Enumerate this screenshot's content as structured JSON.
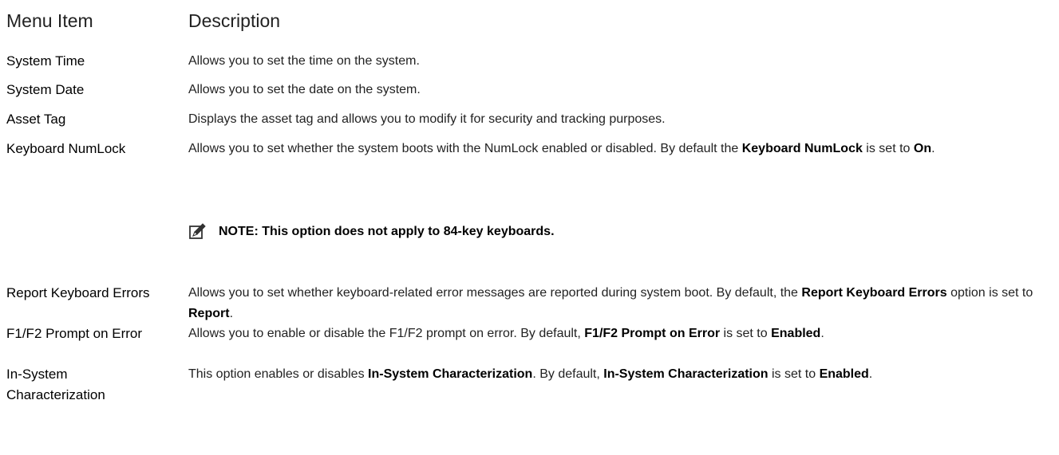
{
  "header": {
    "menu_item": "Menu Item",
    "description": "Description"
  },
  "rows": [
    {
      "item": "System Time",
      "desc": [
        {
          "t": "Allows you to set the time on the system."
        }
      ]
    },
    {
      "item": "System Date",
      "desc": [
        {
          "t": "Allows you to set the date on the system."
        }
      ]
    },
    {
      "item": "Asset Tag",
      "desc": [
        {
          "t": "Displays the asset tag and allows you to modify it for security and tracking purposes."
        }
      ]
    },
    {
      "item": "Keyboard NumLock",
      "desc": [
        {
          "t": "Allows you to set whether the system boots with the NumLock enabled or disabled. By default the "
        },
        {
          "t": "Keyboard NumLock",
          "b": true
        },
        {
          "t": " is set to "
        },
        {
          "t": "On",
          "b": true
        },
        {
          "t": "."
        }
      ],
      "note": "NOTE: This option does not apply to 84-key keyboards."
    },
    {
      "item": "Report Keyboard Errors",
      "desc": [
        {
          "t": "Allows you to set whether keyboard-related error messages are reported during system boot. By default, the "
        },
        {
          "t": "Report Keyboard Errors",
          "b": true
        },
        {
          "t": " option is set to "
        },
        {
          "t": "Report",
          "b": true
        },
        {
          "t": "."
        }
      ]
    },
    {
      "item": "F1/F2 Prompt on Error",
      "desc": [
        {
          "t": "Allows you to enable or disable the F1/F2 prompt on error. By default, "
        },
        {
          "t": "F1/F2 Prompt on Error",
          "b": true
        },
        {
          "t": " is set to "
        },
        {
          "t": "Enabled",
          "b": true
        },
        {
          "t": "."
        }
      ]
    },
    {
      "item": "In-System Characterization",
      "desc": [
        {
          "t": "This option enables or disables "
        },
        {
          "t": "In-System Characterization",
          "b": true
        },
        {
          "t": ". By default, "
        },
        {
          "t": "In-System Characterization",
          "b": true
        },
        {
          "t": " is set to "
        },
        {
          "t": "Enabled",
          "b": true
        },
        {
          "t": "."
        }
      ]
    }
  ],
  "icons": {
    "note": "pencil-note-icon"
  }
}
